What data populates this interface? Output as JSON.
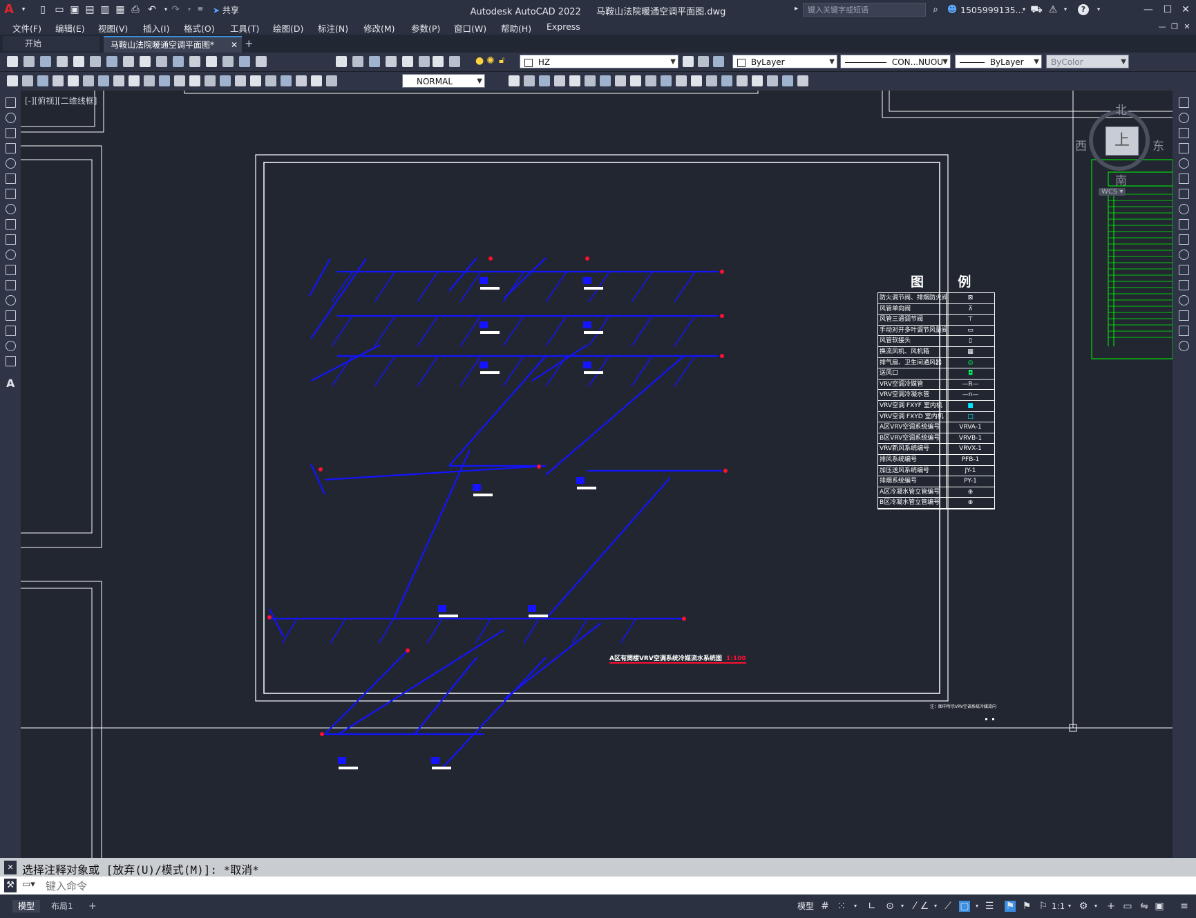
{
  "title_bar": {
    "app_title": "Autodesk AutoCAD 2022",
    "file_name": "马鞍山法院暖通空调平面图.dwg",
    "share_label": "共享",
    "search_placeholder": "键入关键字或短语",
    "user_name": "1505999135...",
    "help_label": "?"
  },
  "menus": [
    "文件(F)",
    "编辑(E)",
    "视图(V)",
    "插入(I)",
    "格式(O)",
    "工具(T)",
    "绘图(D)",
    "标注(N)",
    "修改(M)",
    "参数(P)",
    "窗口(W)",
    "帮助(H)",
    "Express"
  ],
  "tabs": {
    "start": "开始",
    "active": "马鞍山法院暖通空调平面图*",
    "add": "+"
  },
  "toolbar": {
    "layer_name": "HZ",
    "color_value": "ByLayer",
    "linetype_value": "CON...NUOU",
    "lineweight_value": "ByLayer",
    "plotstyle_value": "ByColor",
    "dimstyle_value": "NORMAL"
  },
  "viewport": {
    "label": "[-][俯视][二维线框]"
  },
  "viewcube": {
    "north": "北",
    "south": "南",
    "east": "东",
    "west": "西",
    "face": "上",
    "wcs": "WCS"
  },
  "legend": {
    "title_left": "图",
    "title_right": "例",
    "items": [
      {
        "label": "防火调节阀、排烟防火阀",
        "symbol": "⊠"
      },
      {
        "label": "风管单向阀",
        "symbol": "⊼"
      },
      {
        "label": "风管三通调节阀",
        "symbol": "⊤"
      },
      {
        "label": "手动对开多叶调节风量阀",
        "symbol": "▭"
      },
      {
        "label": "风管软接头",
        "symbol": "▯"
      },
      {
        "label": "换流风机、风机箱",
        "symbol": "▦"
      },
      {
        "label": "排气扇、卫生间通风器",
        "symbol": "◎"
      },
      {
        "label": "送风口",
        "symbol": "◘"
      },
      {
        "label": "VRV空调冷媒管",
        "symbol": "—R—"
      },
      {
        "label": "VRV空调冷凝水管",
        "symbol": "—n—"
      },
      {
        "label": "VRV空调 FXYF 室内机",
        "symbol": "■"
      },
      {
        "label": "VRV空调 FXYD 室内机",
        "symbol": "□"
      },
      {
        "label": "A区VRV空调系统编号",
        "symbol": "VRVA-1"
      },
      {
        "label": "B区VRV空调系统编号",
        "symbol": "VRVB-1"
      },
      {
        "label": "VRV新风系统编号",
        "symbol": "VRVX-1"
      },
      {
        "label": "排风系统编号",
        "symbol": "PFB-1"
      },
      {
        "label": "加压送风系统编号",
        "symbol": "JY-1"
      },
      {
        "label": "排烟系统编号",
        "symbol": "PY-1"
      },
      {
        "label": "A区冷凝水管立管编号",
        "symbol": "⊕"
      },
      {
        "label": "B区冷凝水管立管编号",
        "symbol": "⊕"
      }
    ]
  },
  "drawing": {
    "caption": "A区有関楼VRV空调系统冷媒流水系统图",
    "caption_scale": "1:100",
    "note": "注：图中所示VRV空调系统冷媒流向"
  },
  "command": {
    "history": "选择注释对象或 [放弃(U)/模式(M)]: *取消*",
    "input_placeholder": "键入命令"
  },
  "status": {
    "model_tab": "模型",
    "layout_tab": "布局1",
    "add_tab": "+",
    "model_space": "模型",
    "scale": "1:1"
  },
  "colors": {
    "canvas": "#212630",
    "pipe": "#1414ff",
    "label_red": "#ff1030",
    "frame": "#ffffff",
    "schedule": "#00ff00",
    "accent": "#3b8fe0"
  }
}
